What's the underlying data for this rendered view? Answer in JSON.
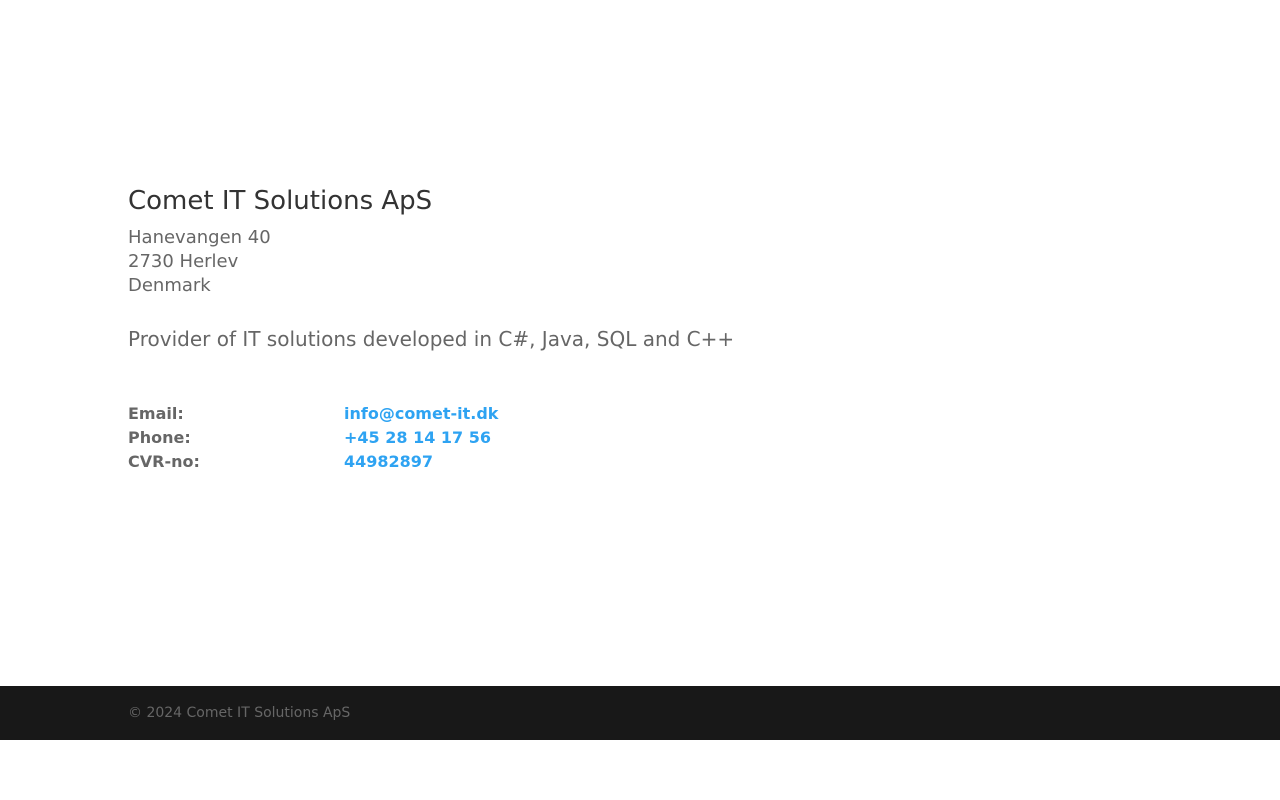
{
  "company": {
    "name": "Comet IT Solutions ApS",
    "address_line1": "Hanevangen 40",
    "address_line2": "2730 Herlev",
    "address_line3": "Denmark",
    "tagline": "Provider of IT solutions developed in C#, Java, SQL and C++"
  },
  "contact": {
    "email_label": "Email:",
    "email_value": "info@comet-it.dk",
    "phone_label": "Phone:",
    "phone_value": "+45 28 14 17 56",
    "cvr_label": "CVR-no:",
    "cvr_value": "44982897"
  },
  "footer": {
    "copyright": "© 2024 Comet IT Solutions ApS"
  },
  "colors": {
    "link": "#2ea3f2",
    "footer_bg": "#181818",
    "heading": "#333333",
    "body_text": "#666666"
  }
}
